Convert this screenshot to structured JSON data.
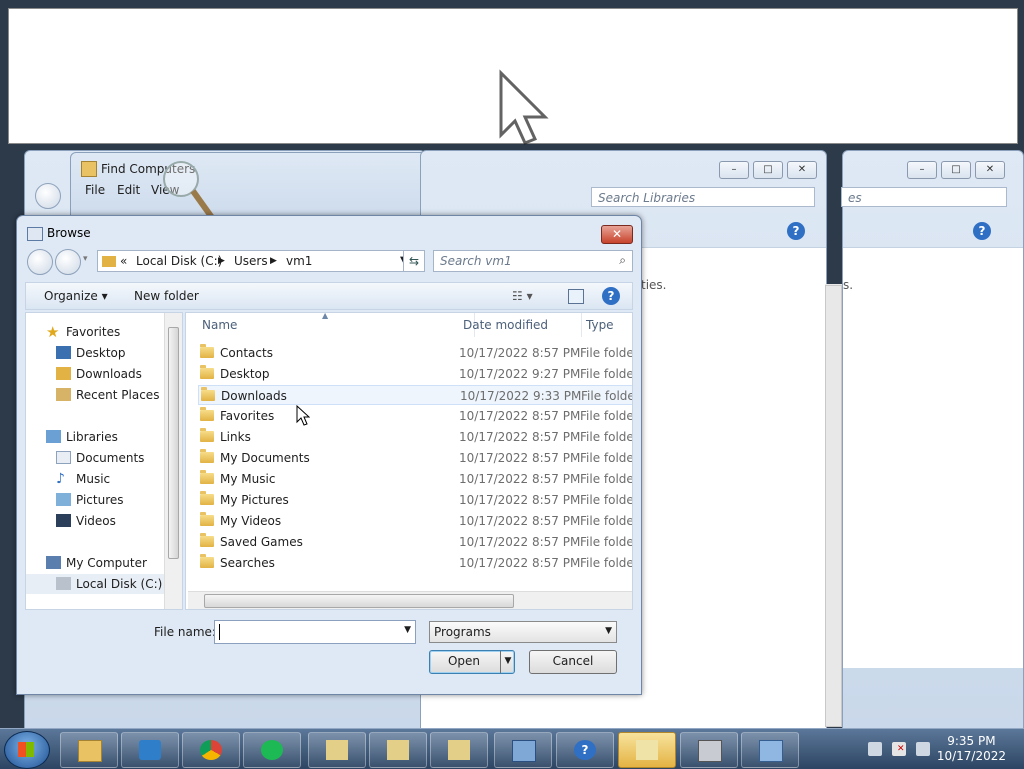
{
  "background_windows": {
    "find_computers": {
      "title": "Find Computers",
      "menu": [
        "File",
        "Edit",
        "View"
      ]
    },
    "libraries_search_1": "Search Libraries",
    "libraries_search_2_partial": "es",
    "properties_partial_1": "ties.",
    "properties_partial_2": "s."
  },
  "browse": {
    "title": "Browse",
    "address": {
      "prefix": "«",
      "parts": [
        "Local Disk (C:)",
        "Users",
        "vm1"
      ]
    },
    "search_placeholder": "Search vm1",
    "toolbar": {
      "organize": "Organize ▾",
      "new_folder": "New folder"
    },
    "nav": {
      "favorites_header": "Favorites",
      "favorites": [
        "Desktop",
        "Downloads",
        "Recent Places"
      ],
      "libraries_header": "Libraries",
      "libraries": [
        "Documents",
        "Music",
        "Pictures",
        "Videos"
      ],
      "computer_header": "My Computer",
      "computer": [
        "Local Disk (C:)"
      ]
    },
    "columns": {
      "name": "Name",
      "date": "Date modified",
      "type": "Type"
    },
    "files": [
      {
        "name": "Contacts",
        "date": "10/17/2022 8:57 PM",
        "type": "File folder"
      },
      {
        "name": "Desktop",
        "date": "10/17/2022 9:27 PM",
        "type": "File folder"
      },
      {
        "name": "Downloads",
        "date": "10/17/2022 9:33 PM",
        "type": "File folder"
      },
      {
        "name": "Favorites",
        "date": "10/17/2022 8:57 PM",
        "type": "File folder"
      },
      {
        "name": "Links",
        "date": "10/17/2022 8:57 PM",
        "type": "File folder"
      },
      {
        "name": "My Documents",
        "date": "10/17/2022 8:57 PM",
        "type": "File folder"
      },
      {
        "name": "My Music",
        "date": "10/17/2022 8:57 PM",
        "type": "File folder"
      },
      {
        "name": "My Pictures",
        "date": "10/17/2022 8:57 PM",
        "type": "File folder"
      },
      {
        "name": "My Videos",
        "date": "10/17/2022 8:57 PM",
        "type": "File folder"
      },
      {
        "name": "Saved Games",
        "date": "10/17/2022 8:57 PM",
        "type": "File folder"
      },
      {
        "name": "Searches",
        "date": "10/17/2022 8:57 PM",
        "type": "File folder"
      }
    ],
    "file_name_label": "File name:",
    "file_name_value": "",
    "filter_value": "Programs",
    "open_label": "Open",
    "cancel_label": "Cancel"
  },
  "taskbar": {
    "icons": [
      "folder-icon",
      "media-player-icon",
      "chrome-icon",
      "spotify-icon",
      "find-computers-icon",
      "find-computers-icon",
      "find-computers-icon",
      "network-drive-icon",
      "help-icon",
      "find-computers-icon",
      "server-icon",
      "network-computer-icon"
    ],
    "time": "9:35 PM",
    "date": "10/17/2022"
  },
  "colors": {
    "accent": "#2f6fc4",
    "selection": "#eef5fd",
    "taskbar": "#3c5778"
  }
}
